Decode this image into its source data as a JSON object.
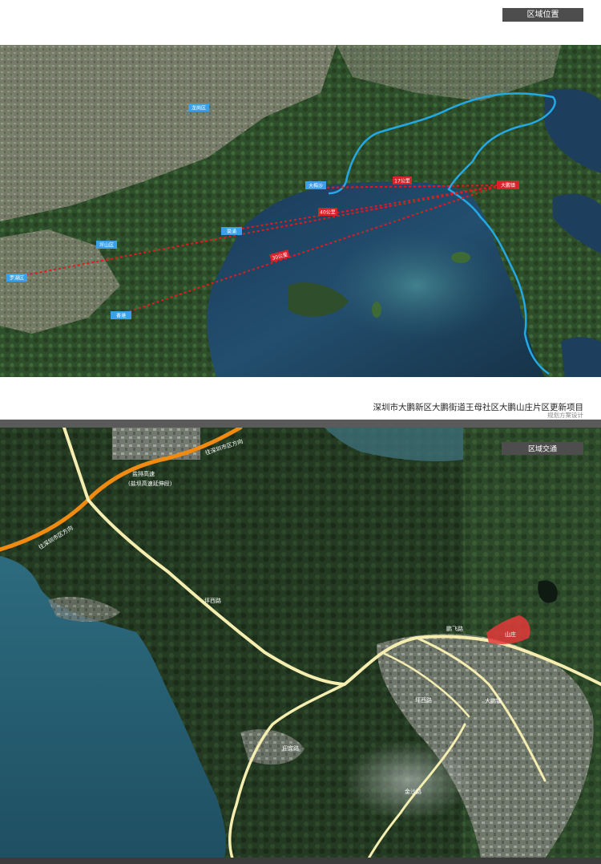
{
  "header": {
    "section_label": "区域位置"
  },
  "map1": {
    "places": [
      {
        "id": "longgang",
        "label": "龙岗区"
      },
      {
        "id": "dameisha",
        "label": "大梅沙"
      },
      {
        "id": "kuichong",
        "label": "葵涌"
      },
      {
        "id": "pingdi",
        "label": "坪山区"
      },
      {
        "id": "luohu",
        "label": "罗湖区"
      },
      {
        "id": "yantian",
        "label": "盐田区"
      },
      {
        "id": "xiangang",
        "label": "香港"
      },
      {
        "id": "project",
        "label": "大鹏镇"
      }
    ],
    "distances": [
      {
        "id": "d1",
        "label": "17公里"
      },
      {
        "id": "d2",
        "label": "40公里"
      },
      {
        "id": "d3",
        "label": "30公里"
      }
    ],
    "colors": {
      "distance_line": "#e11b1b",
      "coastline": "#22a9e6",
      "label_bg": "#3aa0e8",
      "project_bg": "#d9232b"
    }
  },
  "caption": {
    "title": "深圳市大鹏新区大鹏街道王母社区大鹏山庄片区更新项目",
    "subtitle": "规划方案设计"
  },
  "section2": {
    "label": "区域交通",
    "roads": [
      {
        "id": "expressway",
        "label": "盐排高速"
      },
      {
        "id": "expressway-sub",
        "label": "(盐坝高速延伸段)"
      },
      {
        "id": "to-shenzhen-top",
        "label": "往深圳市区方向"
      },
      {
        "id": "to-shenzhen-left",
        "label": "往深圳市区方向"
      },
      {
        "id": "kuiyi",
        "label": "坪西路"
      },
      {
        "id": "pingxi",
        "label": "坪西路"
      },
      {
        "id": "yingbin",
        "label": "迎宾路"
      },
      {
        "id": "jinsha",
        "label": "金沙路"
      },
      {
        "id": "pengfei",
        "label": "鹏飞路"
      },
      {
        "id": "dapeng-center",
        "label": "大鹏镇"
      },
      {
        "id": "site",
        "label": "山庄"
      }
    ],
    "colors": {
      "expressway": "#f08a10",
      "main_road": "#f5eeb0",
      "site": "#e33a3a"
    }
  }
}
